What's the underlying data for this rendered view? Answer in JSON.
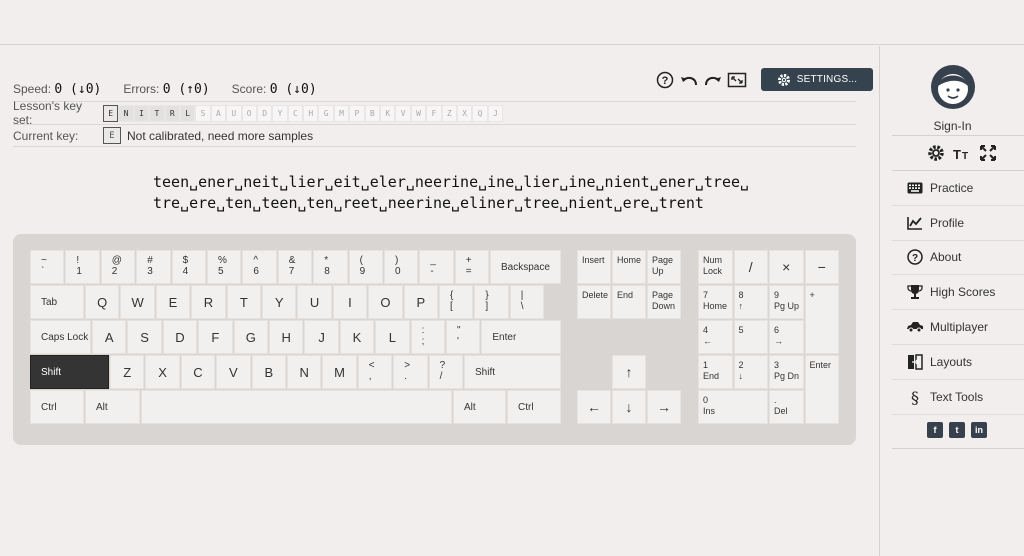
{
  "stats": {
    "speed_label": "Speed:",
    "speed_value": "0 (↓0)",
    "errors_label": "Errors:",
    "errors_value": "0 (↑0)",
    "score_label": "Score:",
    "score_value": "0 (↓0)"
  },
  "toolbar": {
    "settings_label": "SETTINGS..."
  },
  "keyset": {
    "label": "Lesson's key set:",
    "keys": [
      "E",
      "N",
      "I",
      "T",
      "R",
      "L",
      "S",
      "A",
      "U",
      "O",
      "D",
      "Y",
      "C",
      "H",
      "G",
      "M",
      "P",
      "B",
      "K",
      "V",
      "W",
      "F",
      "Z",
      "X",
      "Q",
      "J"
    ],
    "learned_count": 6,
    "current_key": "E"
  },
  "current": {
    "label": "Current key:",
    "key": "E",
    "status": "Not calibrated, need more samples"
  },
  "lesson": {
    "line1": "teen␣ener␣neit␣lier␣eit␣eler␣neerine␣ine␣lier␣ine␣nient␣ener␣tree␣",
    "line2": "tre␣ere␣ten␣teen␣ten␣reet␣neerine␣eliner␣tree␣nient␣ere␣trent"
  },
  "keyboard": {
    "row1": [
      [
        "~",
        "`"
      ],
      [
        "!",
        "1"
      ],
      [
        "@",
        "2"
      ],
      [
        "#",
        "3"
      ],
      [
        "$",
        "4"
      ],
      [
        "%",
        "5"
      ],
      [
        "^",
        "6"
      ],
      [
        "&",
        "7"
      ],
      [
        "*",
        "8"
      ],
      [
        "(",
        "9"
      ],
      [
        ")",
        "0"
      ],
      [
        "_",
        "-"
      ],
      [
        "+",
        "="
      ]
    ],
    "backspace": "Backspace",
    "tab": "Tab",
    "row2": [
      "Q",
      "W",
      "E",
      "R",
      "T",
      "Y",
      "U",
      "I",
      "O",
      "P"
    ],
    "row2_sym": [
      [
        "{",
        "["
      ],
      [
        "}",
        "]"
      ],
      [
        "|",
        "\\"
      ]
    ],
    "caps": "Caps Lock",
    "row3": [
      "A",
      "S",
      "D",
      "F",
      "G",
      "H",
      "J",
      "K",
      "L"
    ],
    "row3_sym": [
      [
        ":",
        ";"
      ],
      [
        "\"",
        "'"
      ]
    ],
    "enter": "Enter",
    "shift": "Shift",
    "row4": [
      "Z",
      "X",
      "C",
      "V",
      "B",
      "N",
      "M"
    ],
    "row4_sym": [
      [
        "<",
        ","
      ],
      [
        ">",
        "."
      ],
      [
        "?",
        "/"
      ]
    ],
    "ctrl": "Ctrl",
    "alt": "Alt",
    "nav": [
      [
        "Insert",
        ""
      ],
      [
        "Home",
        ""
      ],
      [
        "Page",
        "Up"
      ],
      [
        "Delete",
        ""
      ],
      [
        "End",
        ""
      ],
      [
        "Page",
        "Down"
      ]
    ],
    "arrows": [
      "↑",
      "←",
      "↓",
      "→"
    ],
    "numpad": {
      "numlock": [
        "Num",
        "Lock"
      ],
      "div": "/",
      "mul": "×",
      "sub": "−",
      "add": "+",
      "enter": "Enter",
      "n7": [
        "7",
        "Home"
      ],
      "n8": [
        "8",
        "↑"
      ],
      "n9": [
        "9",
        "Pg Up"
      ],
      "n4": [
        "4",
        "←"
      ],
      "n5": [
        "5",
        ""
      ],
      "n6": [
        "6",
        "→"
      ],
      "n1": [
        "1",
        "End"
      ],
      "n2": [
        "2",
        "↓"
      ],
      "n3": [
        "3",
        "Pg Dn"
      ],
      "n0": [
        "0",
        "Ins"
      ],
      "dot": [
        ".",
        "Del"
      ]
    }
  },
  "sidebar": {
    "signin": "Sign-In",
    "nav": [
      {
        "label": "Practice",
        "icon": "keyboard-icon"
      },
      {
        "label": "Profile",
        "icon": "chart-icon"
      },
      {
        "label": "About",
        "icon": "question-icon"
      },
      {
        "label": "High Scores",
        "icon": "trophy-icon"
      },
      {
        "label": "Multiplayer",
        "icon": "car-icon"
      },
      {
        "label": "Layouts",
        "icon": "layouts-icon"
      },
      {
        "label": "Text Tools",
        "icon": "section-icon"
      }
    ],
    "social": [
      "f",
      "t",
      "in"
    ]
  }
}
